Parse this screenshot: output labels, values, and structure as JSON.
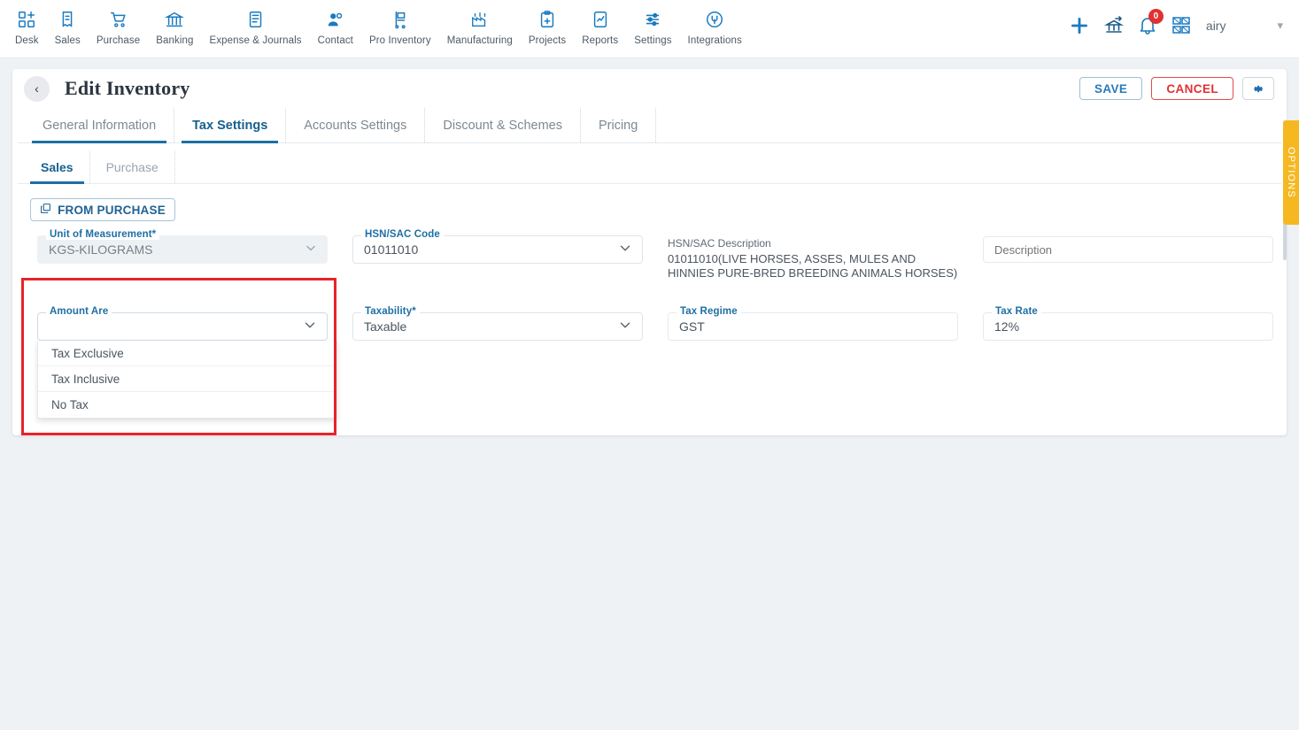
{
  "topnav": {
    "items": [
      {
        "label": "Desk",
        "icon": "dashboard-add-icon"
      },
      {
        "label": "Sales",
        "icon": "receipt-icon"
      },
      {
        "label": "Purchase",
        "icon": "cart-icon"
      },
      {
        "label": "Banking",
        "icon": "bank-icon"
      },
      {
        "label": "Expense & Journals",
        "icon": "journal-icon"
      },
      {
        "label": "Contact",
        "icon": "people-icon"
      },
      {
        "label": "Pro Inventory",
        "icon": "inventory-cart-icon"
      },
      {
        "label": "Manufacturing",
        "icon": "factory-icon"
      },
      {
        "label": "Projects",
        "icon": "clipboard-add-icon"
      },
      {
        "label": "Reports",
        "icon": "report-chart-icon"
      },
      {
        "label": "Settings",
        "icon": "sliders-icon"
      },
      {
        "label": "Integrations",
        "icon": "plug-circle-icon"
      }
    ],
    "right": {
      "add_icon": "plus-icon",
      "transfer_icon": "bank-transfer-icon",
      "bell_icon": "notification-bell-icon",
      "notification_count": "0",
      "grid_icon": "grid-apps-icon",
      "username": "airy",
      "caret_icon": "chevron-down-icon"
    }
  },
  "header": {
    "back_icon": "chevron-left-icon",
    "title": "Edit Inventory",
    "save_label": "SAVE",
    "cancel_label": "CANCEL",
    "gear_icon": "gear-icon"
  },
  "tabs": [
    {
      "label": "General Information",
      "active": false
    },
    {
      "label": "Tax Settings",
      "active": true
    },
    {
      "label": "Accounts Settings",
      "active": false
    },
    {
      "label": "Discount & Schemes",
      "active": false
    },
    {
      "label": "Pricing",
      "active": false
    }
  ],
  "subtabs": [
    {
      "label": "Sales",
      "active": true
    },
    {
      "label": "Purchase",
      "active": false
    }
  ],
  "from_purchase": {
    "label": "FROM PURCHASE",
    "icon": "copy-icon"
  },
  "fields": {
    "unit_of_measurement": {
      "label": "Unit of Measurement",
      "required": "*",
      "value": "KGS-KILOGRAMS",
      "chevron": "chevron-down-icon"
    },
    "hsn_sac_code": {
      "label": "HSN/SAC Code",
      "value": "01011010",
      "chevron": "chevron-down-icon"
    },
    "hsn_sac_description": {
      "label": "HSN/SAC Description",
      "value": "01011010(LIVE HORSES, ASSES, MULES AND HINNIES PURE-BRED BREEDING ANIMALS HORSES)"
    },
    "description": {
      "placeholder": "Description",
      "value": ""
    },
    "amount_are": {
      "label": "Amount Are",
      "value": "",
      "chevron": "chevron-down-icon",
      "options": [
        "Tax Exclusive",
        "Tax Inclusive",
        "No Tax"
      ]
    },
    "taxability": {
      "label": "Taxability",
      "required": "*",
      "value": "Taxable",
      "chevron": "chevron-down-icon"
    },
    "tax_regime": {
      "label": "Tax Regime",
      "value": "GST"
    },
    "tax_rate": {
      "label": "Tax Rate",
      "value": "12%"
    }
  },
  "options_panel": {
    "label": "OPTIONS"
  },
  "colors": {
    "accent_blue": "#1d6fa5",
    "danger_red": "#e03131",
    "annotation_red": "#e8232a",
    "options_yellow": "#f5b820",
    "page_bg": "#eef2f5"
  }
}
